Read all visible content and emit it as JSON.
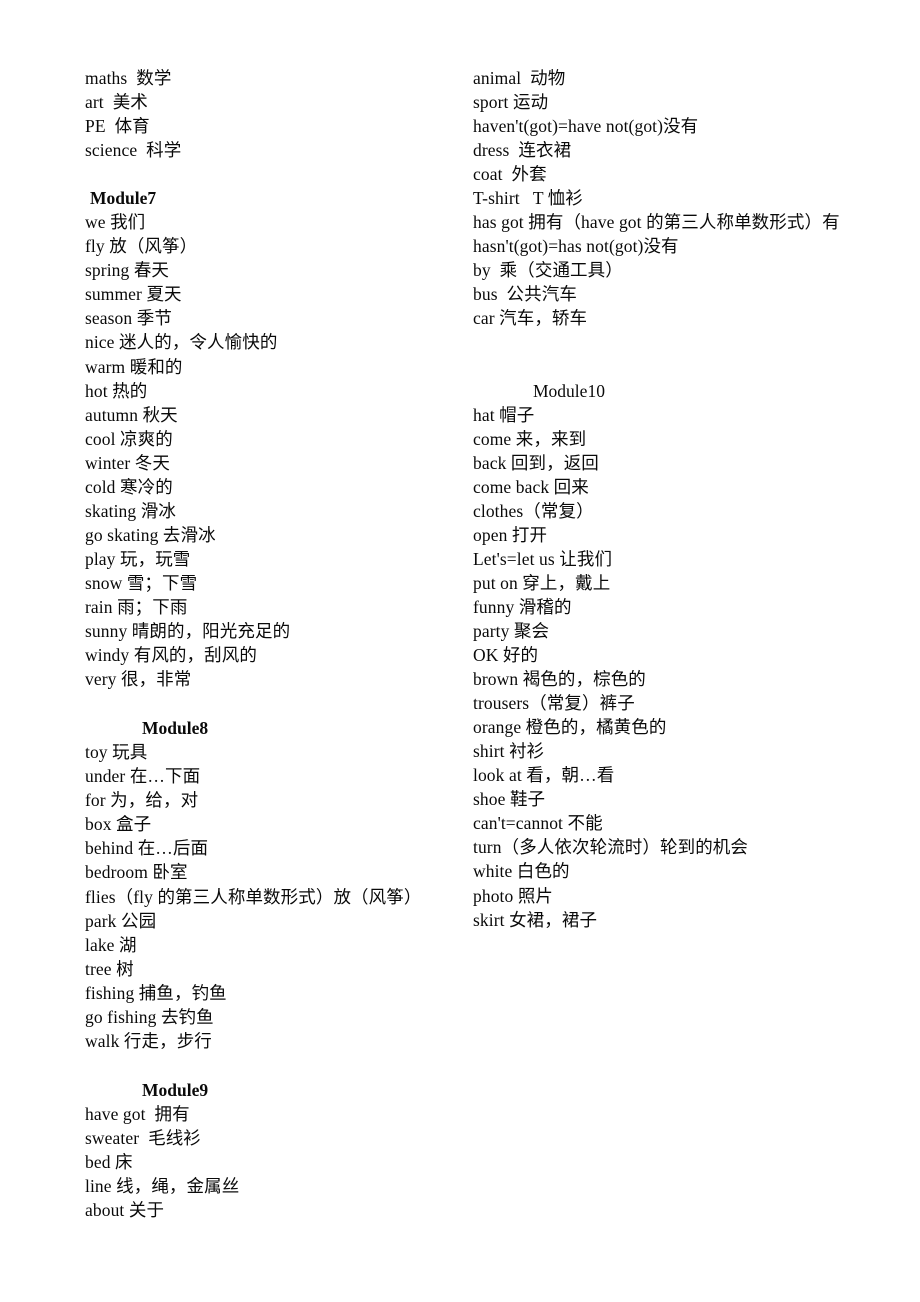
{
  "document": {
    "type": "vocabulary-list",
    "language_pair": "English-Chinese",
    "columns": [
      {
        "id": "left",
        "blocks": [
          {
            "kind": "entries",
            "items": [
              "maths  数学",
              "art  美术",
              "PE  体育",
              "science  科学"
            ]
          },
          {
            "kind": "spacer",
            "size": 1
          },
          {
            "kind": "heading",
            "text": "Module7",
            "bold": true,
            "indent": 1
          },
          {
            "kind": "entries",
            "items": [
              "we 我们",
              "fly 放（风筝）",
              "spring 春天",
              "summer 夏天",
              "season 季节",
              "nice 迷人的，令人愉快的",
              "warm 暖和的",
              "hot 热的",
              "autumn 秋天",
              "cool 凉爽的",
              "winter 冬天",
              "cold 寒冷的",
              "skating 滑冰",
              "go skating 去滑冰",
              "play 玩，玩雪",
              "snow 雪；下雪",
              "rain 雨；下雨",
              "sunny 晴朗的，阳光充足的",
              "windy 有风的，刮风的",
              "very 很，非常"
            ]
          },
          {
            "kind": "spacer",
            "size": 2
          },
          {
            "kind": "heading",
            "text": "Module8",
            "bold": true,
            "indent": 2
          },
          {
            "kind": "entries",
            "items": [
              "toy 玩具",
              "under 在…下面",
              "for 为，给，对",
              "box 盒子",
              "behind 在…后面",
              "bedroom 卧室",
              "flies（fly 的第三人称单数形式）放（风筝）",
              "park 公园",
              "lake 湖",
              "tree 树",
              "fishing 捕鱼，钓鱼",
              "go fishing 去钓鱼",
              "walk 行走，步行"
            ]
          },
          {
            "kind": "spacer",
            "size": 2
          },
          {
            "kind": "heading",
            "text": "Module9",
            "bold": true,
            "indent": 2
          },
          {
            "kind": "entries",
            "items": [
              "have got  拥有",
              "sweater  毛线衫",
              "bed 床",
              "line 线，绳，金属丝",
              "about 关于"
            ]
          }
        ]
      },
      {
        "id": "right",
        "blocks": [
          {
            "kind": "entries",
            "items": [
              "animal  动物",
              "sport 运动",
              "haven't(got)=have not(got)没有",
              "dress  连衣裙",
              "coat  外套",
              "T-shirt   T 恤衫",
              "has got  拥有（have got 的第三人称单数形式）有",
              "hasn't(got)=has not(got)没有",
              "by  乘（交通工具）",
              "bus  公共汽车",
              "car 汽车，轿车"
            ]
          },
          {
            "kind": "spacer",
            "size": "right-1"
          },
          {
            "kind": "heading",
            "text": "Module10",
            "bold": false,
            "indent": 3
          },
          {
            "kind": "entries",
            "items": [
              "hat 帽子",
              "come 来，来到",
              "back 回到，返回",
              "come back 回来",
              "clothes（常复）",
              "open 打开",
              "Let's=let us 让我们",
              "put on 穿上，戴上",
              "funny 滑稽的",
              "party 聚会",
              "OK 好的",
              "brown 褐色的，棕色的",
              "trousers（常复）裤子",
              "orange 橙色的，橘黄色的",
              "shirt 衬衫",
              "look at 看，朝…看",
              "shoe 鞋子",
              "can't=cannot 不能",
              "turn（多人依次轮流时）轮到的机会",
              "white 白色的",
              "photo 照片",
              "skirt 女裙，裙子"
            ]
          }
        ]
      }
    ]
  }
}
